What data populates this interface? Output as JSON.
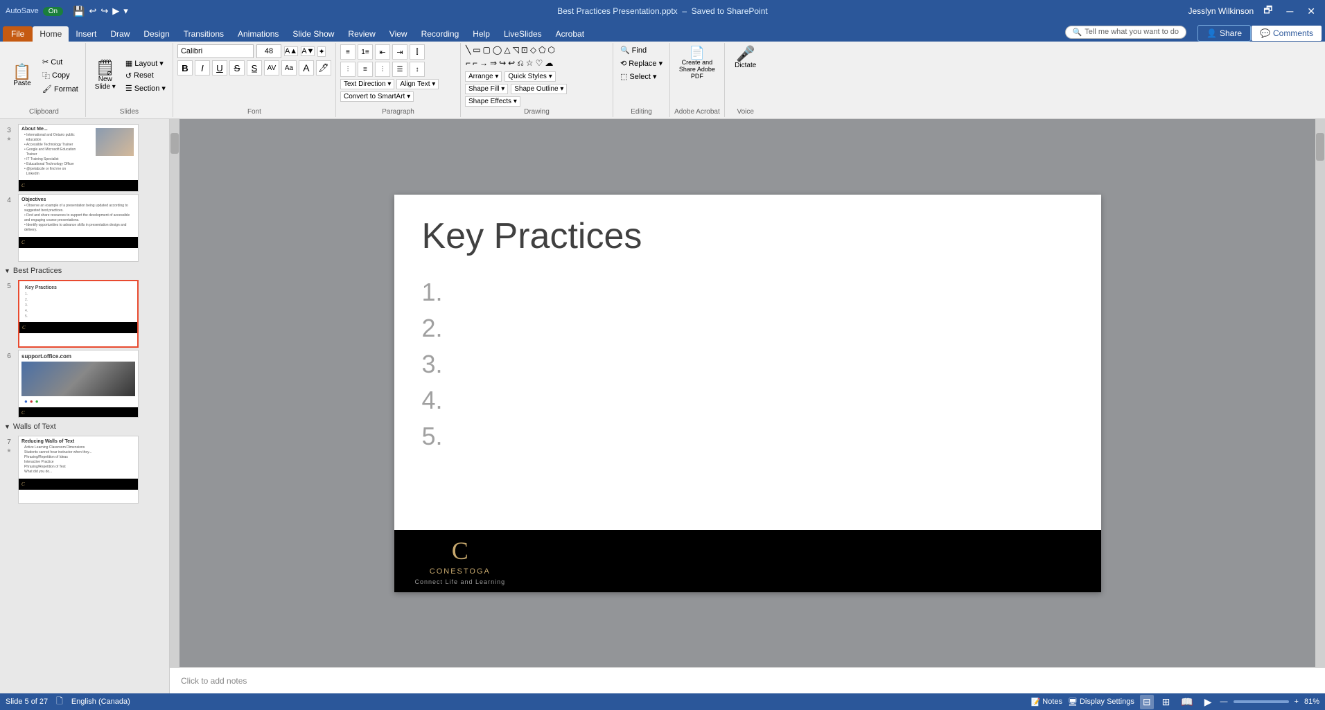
{
  "titleBar": {
    "autosave": "AutoSave",
    "autosaveState": "On",
    "title": "Best Practices Presentation.pptx",
    "savedStatus": "Saved to SharePoint",
    "userName": "Jesslyn Wilkinson"
  },
  "tabs": [
    {
      "id": "file",
      "label": "File",
      "active": false
    },
    {
      "id": "home",
      "label": "Home",
      "active": true
    },
    {
      "id": "insert",
      "label": "Insert",
      "active": false
    },
    {
      "id": "draw",
      "label": "Draw",
      "active": false
    },
    {
      "id": "design",
      "label": "Design",
      "active": false
    },
    {
      "id": "transitions",
      "label": "Transitions",
      "active": false
    },
    {
      "id": "animations",
      "label": "Animations",
      "active": false
    },
    {
      "id": "slideshow",
      "label": "Slide Show",
      "active": false
    },
    {
      "id": "review",
      "label": "Review",
      "active": false
    },
    {
      "id": "view",
      "label": "View",
      "active": false
    },
    {
      "id": "recording",
      "label": "Recording",
      "active": false
    },
    {
      "id": "help",
      "label": "Help",
      "active": false
    },
    {
      "id": "liveslides",
      "label": "LiveSlides",
      "active": false
    },
    {
      "id": "acrobat",
      "label": "Acrobat",
      "active": false
    }
  ],
  "ribbon": {
    "groups": [
      {
        "id": "clipboard",
        "label": "Clipboard",
        "items": [
          "Paste",
          "Cut",
          "Copy",
          "Format Painter"
        ]
      },
      {
        "id": "slides",
        "label": "Slides",
        "items": [
          "New Slide",
          "Layout",
          "Reset",
          "Section"
        ]
      },
      {
        "id": "font",
        "label": "Font",
        "fontName": "Calibri",
        "fontSize": "48",
        "items": [
          "Bold",
          "Italic",
          "Underline",
          "Strikethrough",
          "Font Color",
          "Highlight"
        ]
      },
      {
        "id": "paragraph",
        "label": "Paragraph",
        "items": [
          "Bullets",
          "Numbering",
          "Decrease Indent",
          "Increase Indent",
          "Text Direction",
          "Align Text",
          "Convert to SmartArt"
        ]
      },
      {
        "id": "drawing",
        "label": "Drawing",
        "items": [
          "Arrange",
          "Quick Styles",
          "Shape Fill",
          "Shape Outline",
          "Shape Effects",
          "Find",
          "Replace",
          "Select"
        ]
      },
      {
        "id": "editing",
        "label": "Editing",
        "items": [
          "Find",
          "Replace",
          "Select"
        ]
      },
      {
        "id": "adobe",
        "label": "Adobe Acrobat",
        "items": [
          "Create and Share Adobe PDF"
        ]
      },
      {
        "id": "voice",
        "label": "Voice",
        "items": [
          "Dictate"
        ]
      }
    ],
    "tellMe": "Tell me what you want to do",
    "shareLabel": "Share",
    "commentsLabel": "Comments"
  },
  "slides": [
    {
      "num": "3",
      "starred": true,
      "title": "About Me...",
      "hasPhoto": true,
      "section": null
    },
    {
      "num": "4",
      "starred": false,
      "title": "Objectives",
      "hasPhoto": false,
      "section": null
    },
    {
      "num": "5",
      "starred": false,
      "title": "Key Practices",
      "active": true,
      "section": "Best Practices"
    },
    {
      "num": "6",
      "starred": false,
      "title": "support.office.com",
      "hasWebImage": true,
      "section": null
    },
    {
      "num": "7",
      "starred": true,
      "title": "Reducing Walls of Text",
      "section": "Walls of Text"
    }
  ],
  "currentSlide": {
    "title": "Key Practices",
    "listItems": [
      "1.",
      "2.",
      "3.",
      "4.",
      "5."
    ],
    "footer": {
      "logoC": "C",
      "logoName": "CONESTOGA",
      "logoTagline": "Connect Life and Learning"
    }
  },
  "notes": {
    "placeholder": "Click to add notes"
  },
  "statusBar": {
    "slideInfo": "Slide 5 of 27",
    "language": "English (Canada)",
    "notesLabel": "Notes",
    "displaySettings": "Display Settings",
    "zoom": "81%"
  }
}
